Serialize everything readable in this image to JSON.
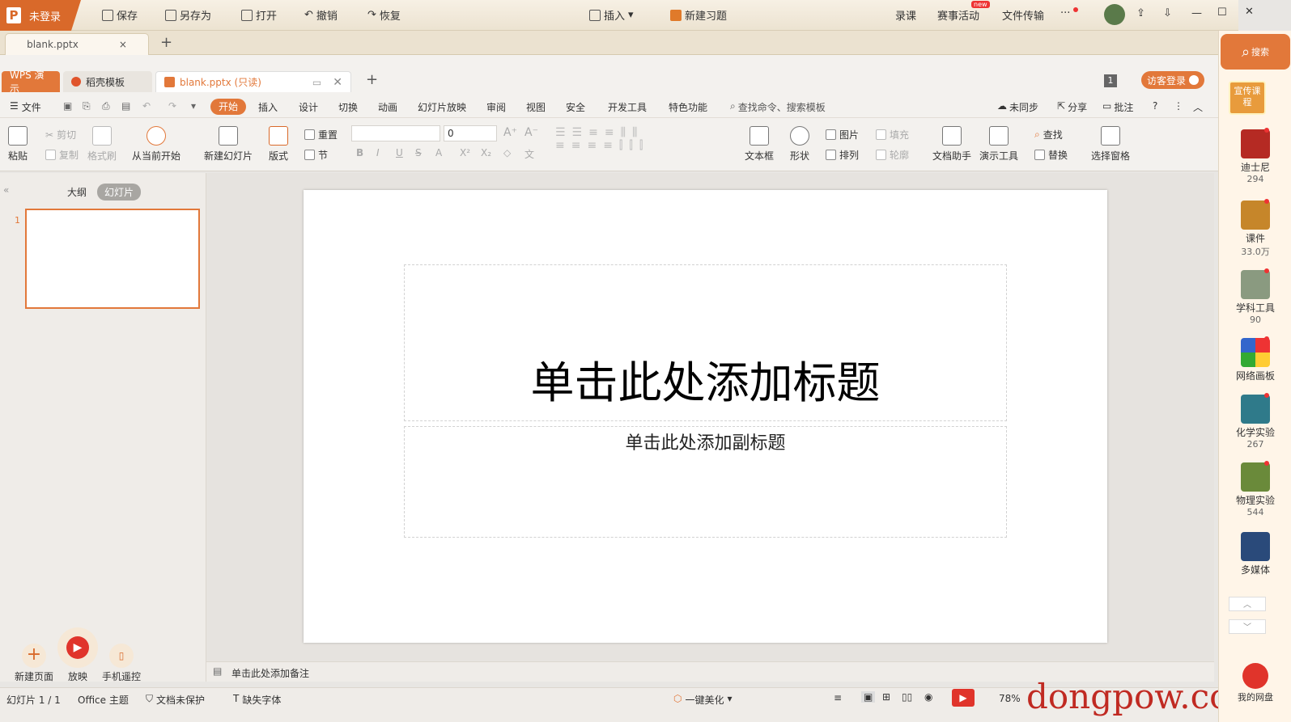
{
  "titlebar": {
    "login": "未登录",
    "save": "保存",
    "save_as": "另存为",
    "open": "打开",
    "undo": "撤销",
    "redo": "恢复",
    "insert": "插入",
    "new_exercise": "新建习题",
    "record": "录课",
    "contest": "赛事活动",
    "new_badge": "new",
    "file_transfer": "文件传输",
    "more": "···"
  },
  "doc_tab": {
    "label": "blank.pptx",
    "close": "×",
    "add": "+"
  },
  "window_tabs": {
    "app": "WPS 演示",
    "template": "稻壳模板",
    "file": "blank.pptx (只读)",
    "add": "+",
    "page_num": "1",
    "visitor_login": "访客登录"
  },
  "menu": {
    "file": "文件",
    "tabs": [
      "开始",
      "插入",
      "设计",
      "切换",
      "动画",
      "幻灯片放映",
      "审阅",
      "视图",
      "安全",
      "开发工具",
      "特色功能"
    ],
    "search": "查找命令、搜索模板",
    "sync": "未同步",
    "share": "分享",
    "comment": "批注",
    "help": "?"
  },
  "ribbon": {
    "paste": "粘贴",
    "cut": "剪切",
    "copy": "复制",
    "format_painter": "格式刷",
    "play_from_current": "从当前开始",
    "new_slide": "新建幻灯片",
    "layout": "版式",
    "reset": "重置",
    "section": "节",
    "font_size": "0",
    "textbox": "文本框",
    "shape": "形状",
    "picture": "图片",
    "fill": "填充",
    "arrange": "排列",
    "outline": "轮廓",
    "doc_assistant": "文档助手",
    "present_tools": "演示工具",
    "find": "查找",
    "replace": "替换",
    "select_pane": "选择窗格",
    "bold": "B",
    "italic": "I",
    "underline": "U",
    "strike": "S",
    "font_color": "A"
  },
  "left_pane": {
    "outline_tab": "大纲",
    "slides_tab": "幻灯片",
    "slide_number": "1",
    "new_page": "新建页面",
    "play": "放映",
    "phone_remote": "手机遥控"
  },
  "slide": {
    "title": "单击此处添加标题",
    "subtitle": "单击此处添加副标题"
  },
  "notes": {
    "placeholder": "单击此处添加备注"
  },
  "status": {
    "slide_index": "幻灯片 1 / 1",
    "theme": "Office 主题",
    "protection": "文档未保护",
    "missing_font": "缺失字体",
    "beautify": "一键美化",
    "zoom": "78%"
  },
  "watermark": "dongpow.com",
  "sidebar": {
    "search": "搜索",
    "course": "宣传课程",
    "items": [
      {
        "label": "迪士尼",
        "count": "294"
      },
      {
        "label": "课件",
        "count": "33.0万"
      },
      {
        "label": "学科工具",
        "count": "90"
      },
      {
        "label": "网络画板",
        "count": ""
      },
      {
        "label": "化学实验",
        "count": "267"
      },
      {
        "label": "物理实验",
        "count": "544"
      },
      {
        "label": "多媒体",
        "count": ""
      }
    ],
    "my_cloud": "我的网盘"
  },
  "colors": {
    "accent": "#d9692a",
    "active_tab": "#e2783a",
    "sidebar_bg": "#fff5e8"
  }
}
